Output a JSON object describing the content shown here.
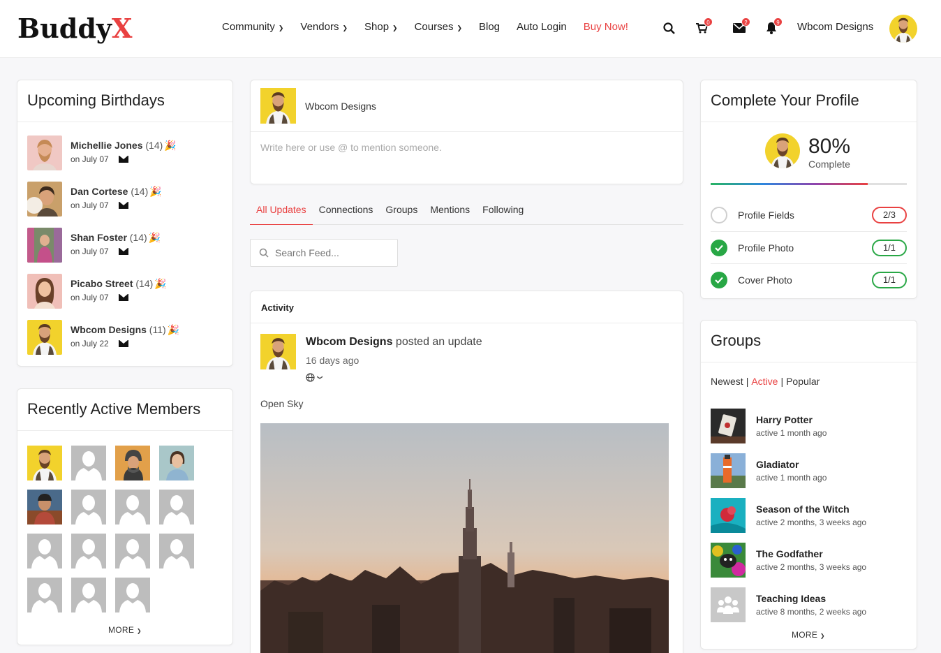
{
  "header": {
    "logo_main": "Buddy",
    "logo_accent": "X",
    "nav": [
      {
        "label": "Community",
        "dropdown": true
      },
      {
        "label": "Vendors",
        "dropdown": true
      },
      {
        "label": "Shop",
        "dropdown": true
      },
      {
        "label": "Courses",
        "dropdown": true
      },
      {
        "label": "Blog",
        "dropdown": false
      },
      {
        "label": "Auto Login",
        "dropdown": false
      },
      {
        "label": "Buy Now!",
        "dropdown": false
      }
    ],
    "cart_count": "0",
    "messages_count": "2",
    "notifications_count": "9",
    "user_name": "Wbcom Designs",
    "accent_color": "#e94141"
  },
  "birthdays": {
    "title": "Upcoming Birthdays",
    "items": [
      {
        "name": "Michellie Jones",
        "age": "(14)",
        "date": "on July 07"
      },
      {
        "name": "Dan Cortese",
        "age": "(14)",
        "date": "on July 07"
      },
      {
        "name": "Shan Foster",
        "age": "(14)",
        "date": "on July 07"
      },
      {
        "name": "Picabo Street",
        "age": "(14)",
        "date": "on July 07"
      },
      {
        "name": "Wbcom Designs",
        "age": "(11)",
        "date": "on July 22"
      }
    ]
  },
  "members": {
    "title": "Recently Active Members",
    "more": "MORE"
  },
  "post_box": {
    "user_name": "Wbcom Designs",
    "placeholder": "Write here or use @ to mention someone."
  },
  "tabs": [
    "All Updates",
    "Connections",
    "Groups",
    "Mentions",
    "Following"
  ],
  "search_feed": {
    "placeholder": "Search Feed..."
  },
  "activity": {
    "heading": "Activity",
    "user": "Wbcom Designs",
    "action": "posted an update",
    "time": "16 days ago",
    "text": "Open Sky"
  },
  "profile": {
    "title": "Complete Your Profile",
    "percent": "80%",
    "percent_value": 0.8,
    "sub": "Complete",
    "rows": [
      {
        "label": "Profile Fields",
        "count": "2/3",
        "done": false
      },
      {
        "label": "Profile Photo",
        "count": "1/1",
        "done": true
      },
      {
        "label": "Cover Photo",
        "count": "1/1",
        "done": true
      }
    ]
  },
  "groups": {
    "title": "Groups",
    "filters": [
      "Newest",
      "Active",
      "Popular"
    ],
    "items": [
      {
        "name": "Harry Potter",
        "sub": "active 1 month ago"
      },
      {
        "name": "Gladiator",
        "sub": "active 1 month ago"
      },
      {
        "name": "Season of the Witch",
        "sub": "active 2 months, 3 weeks ago"
      },
      {
        "name": "The Godfather",
        "sub": "active 2 months, 3 weeks ago"
      },
      {
        "name": "Teaching Ideas",
        "sub": "active 8 months, 2 weeks ago"
      }
    ],
    "more": "MORE"
  }
}
